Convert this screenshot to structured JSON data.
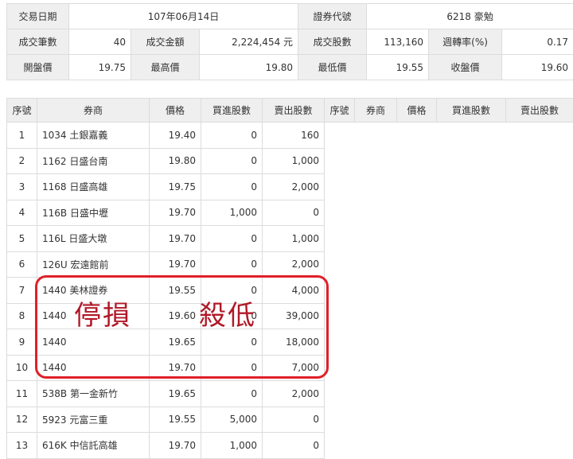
{
  "info": {
    "row1": {
      "date_label": "交易日期",
      "date_value": "107年06月14日",
      "code_label": "證券代號",
      "code_value": "6218 豪勉"
    },
    "row2": {
      "count_label": "成交筆數",
      "count_value": "40",
      "amount_label": "成交金額",
      "amount_value": "2,224,454 元",
      "shares_label": "成交股數",
      "shares_value": "113,160",
      "turnover_label": "週轉率(%)",
      "turnover_value": "0.17"
    },
    "row3": {
      "open_label": "開盤價",
      "open_value": "19.75",
      "high_label": "最高價",
      "high_value": "19.80",
      "low_label": "最低價",
      "low_value": "19.55",
      "close_label": "收盤價",
      "close_value": "19.60"
    }
  },
  "trades": {
    "headers": [
      "序號",
      "券商",
      "價格",
      "買進股數",
      "賣出股數",
      "序號",
      "券商",
      "價格",
      "買進股數",
      "賣出股數"
    ],
    "rows": [
      {
        "no": "1",
        "broker": "1034 土銀嘉義",
        "price": "19.40",
        "buy": "0",
        "sell": "160"
      },
      {
        "no": "2",
        "broker": "1162 日盛台南",
        "price": "19.80",
        "buy": "0",
        "sell": "1,000"
      },
      {
        "no": "3",
        "broker": "1168 日盛高雄",
        "price": "19.75",
        "buy": "0",
        "sell": "2,000"
      },
      {
        "no": "4",
        "broker": "116B 日盛中壢",
        "price": "19.70",
        "buy": "1,000",
        "sell": "0"
      },
      {
        "no": "5",
        "broker": "116L 日盛大墩",
        "price": "19.70",
        "buy": "0",
        "sell": "1,000"
      },
      {
        "no": "6",
        "broker": "126U 宏遠館前",
        "price": "19.70",
        "buy": "0",
        "sell": "2,000"
      },
      {
        "no": "7",
        "broker": "1440 美林證券",
        "price": "19.55",
        "buy": "0",
        "sell": "4,000"
      },
      {
        "no": "8",
        "broker": "1440",
        "price": "19.60",
        "buy": "0",
        "sell": "39,000"
      },
      {
        "no": "9",
        "broker": "1440",
        "price": "19.65",
        "buy": "0",
        "sell": "18,000"
      },
      {
        "no": "10",
        "broker": "1440",
        "price": "19.70",
        "buy": "0",
        "sell": "7,000"
      },
      {
        "no": "11",
        "broker": "538B 第一金新竹",
        "price": "19.65",
        "buy": "0",
        "sell": "2,000"
      },
      {
        "no": "12",
        "broker": "5923 元富三重",
        "price": "19.55",
        "buy": "5,000",
        "sell": "0"
      },
      {
        "no": "13",
        "broker": "616K 中信託高雄",
        "price": "19.70",
        "buy": "1,000",
        "sell": "0"
      }
    ]
  },
  "annotations": {
    "left": "停損",
    "right": "殺低",
    "color": "#b01828",
    "box_color": "#e0202a"
  }
}
